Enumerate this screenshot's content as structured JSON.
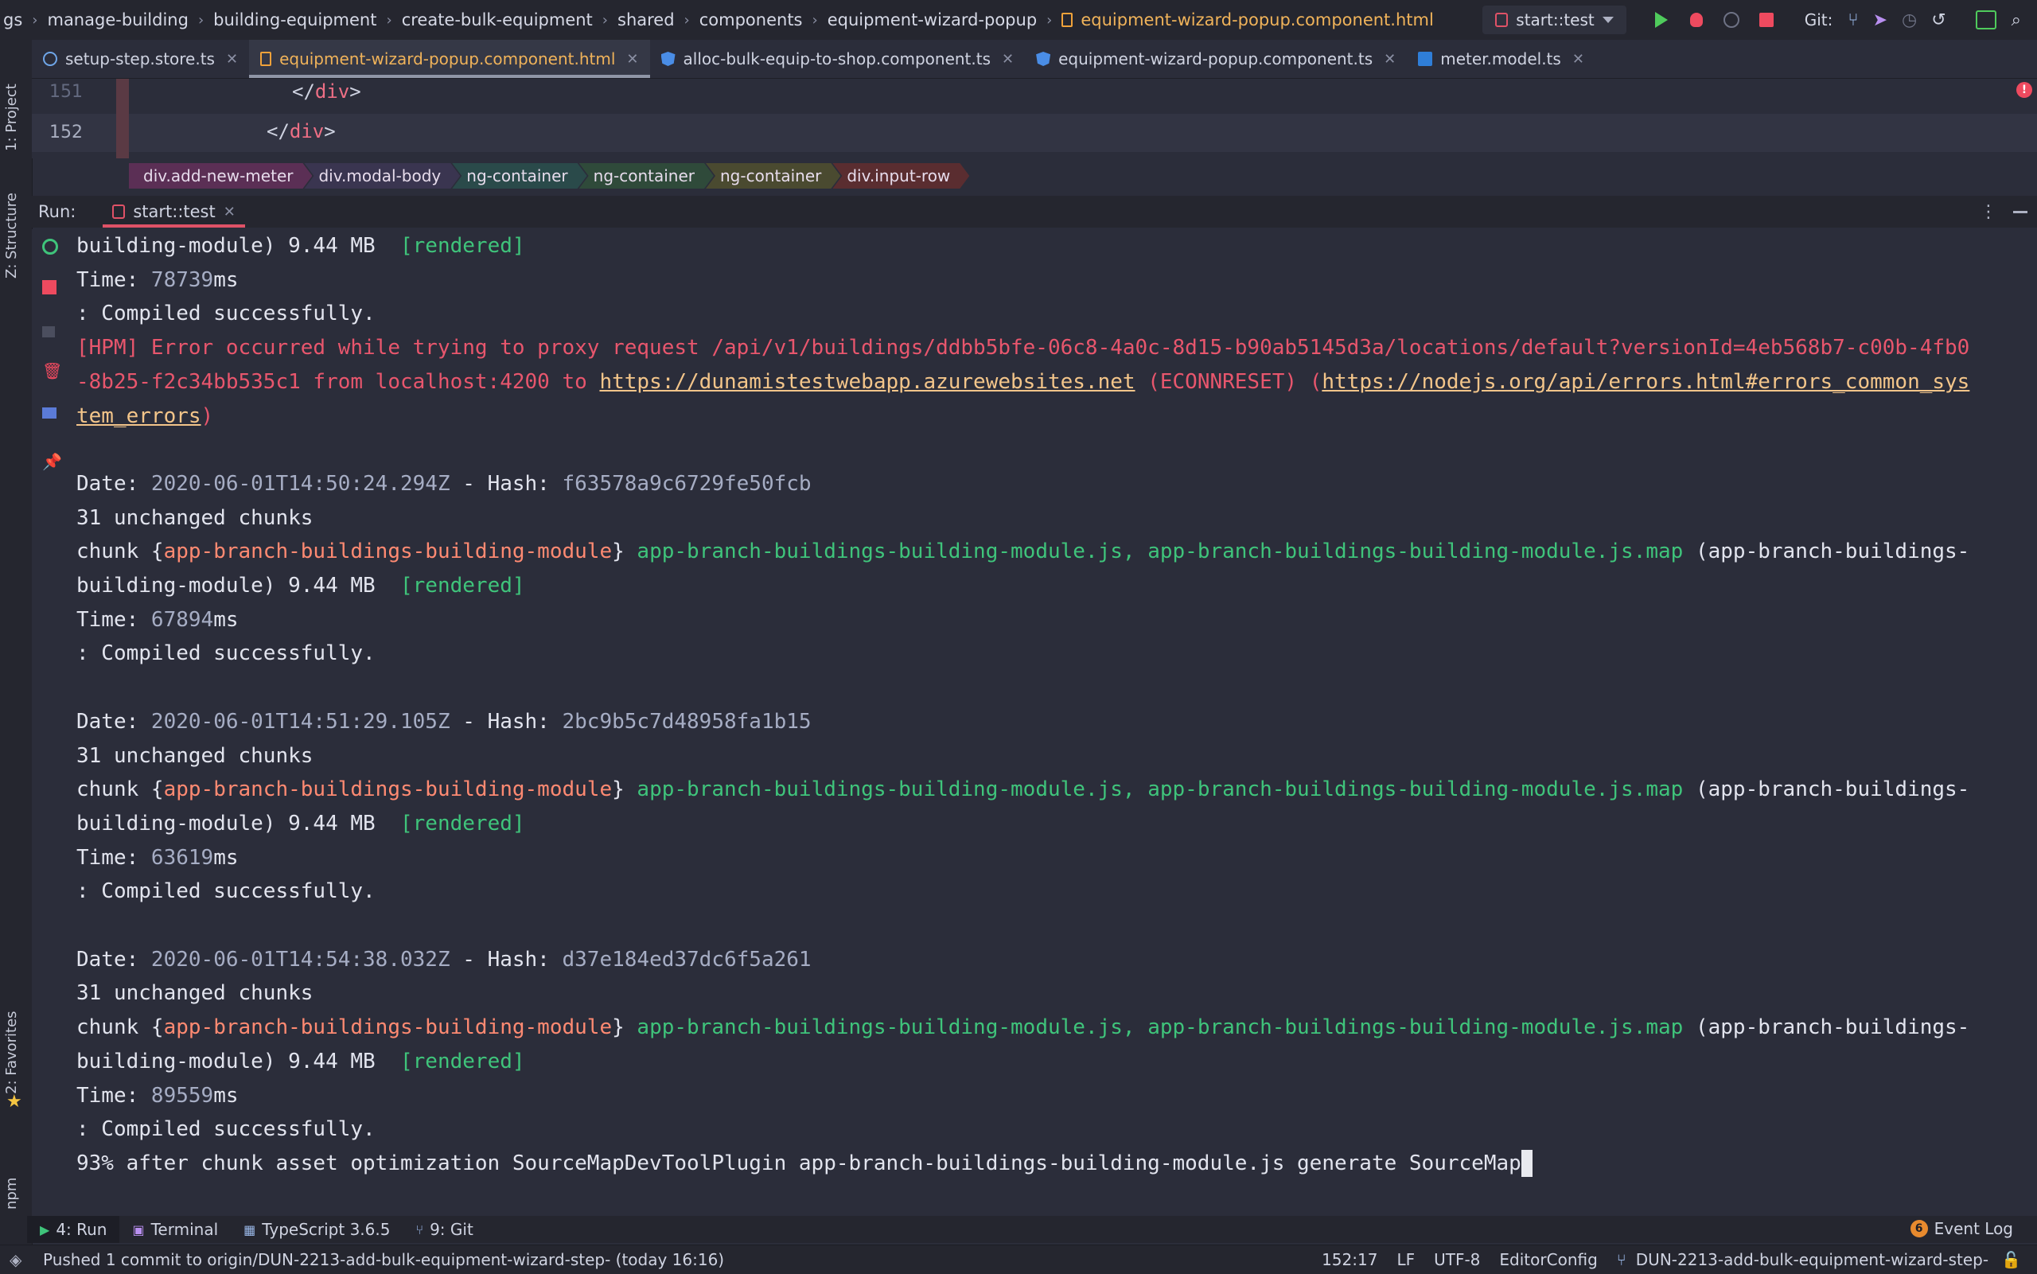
{
  "navbar": {
    "crumbs": [
      "gs",
      "manage-building",
      "building-equipment",
      "create-bulk-equipment",
      "shared",
      "components",
      "equipment-wizard-popup"
    ],
    "current_file": "equipment-wizard-popup.component.html",
    "run_config": "start::test",
    "git_label": "Git:"
  },
  "tool_strip": {
    "project": "1: Project",
    "structure": "Z: Structure",
    "favorites": "2: Favorites",
    "npm": "npm"
  },
  "tabs": [
    {
      "name": "setup-step.store.ts",
      "icon": "store"
    },
    {
      "name": "equipment-wizard-popup.component.html",
      "icon": "html",
      "active": true
    },
    {
      "name": "alloc-bulk-equip-to-shop.component.ts",
      "icon": "ng"
    },
    {
      "name": "equipment-wizard-popup.component.ts",
      "icon": "ng"
    },
    {
      "name": "meter.model.ts",
      "icon": "ts"
    }
  ],
  "editor": {
    "lines": [
      {
        "num": "151",
        "open": "</",
        "tag": "div",
        "close": ">"
      },
      {
        "num": "152",
        "open": "</",
        "tag": "div",
        "close": ">"
      }
    ],
    "error_count": "!"
  },
  "tag_crumbs": [
    {
      "label": "div.add-new-meter",
      "color": "#5b2f55"
    },
    {
      "label": "div.modal-body",
      "color": "#3a3550"
    },
    {
      "label": "ng-container",
      "color": "#2a4a4a"
    },
    {
      "label": "ng-container",
      "color": "#2f4a3a"
    },
    {
      "label": "ng-container",
      "color": "#4a4a30"
    },
    {
      "label": "div.input-row",
      "color": "#5a2d30"
    }
  ],
  "run": {
    "label": "Run:",
    "tab": "start::test"
  },
  "console": {
    "lines": [
      [
        {
          "t": "building-module) 9.44 MB  "
        },
        {
          "t": "[rendered]",
          "c": "green"
        }
      ],
      [
        {
          "t": "Time: "
        },
        {
          "t": "78739",
          "c": "gray"
        },
        {
          "t": "ms"
        }
      ],
      [
        {
          "t": ": Compiled successfully."
        }
      ],
      [
        {
          "t": "[HPM] Error occurred while trying to proxy request /api/v1/buildings/ddbb5bfe-06c8-4a0c-8d15-b90ab5145d3a/locations/default?versionId=4eb568b7-c00b-4fb0",
          "c": "err"
        }
      ],
      [
        {
          "t": "-8b25-f2c34bb535c1 from localhost:4200 to ",
          "c": "err"
        },
        {
          "t": "https://dunamistestwebapp.azurewebsites.net",
          "c": "link"
        },
        {
          "t": " (ECONNRESET) (",
          "c": "err"
        },
        {
          "t": "https://nodejs.org/api/errors.html#errors_common_sys",
          "c": "link"
        }
      ],
      [
        {
          "t": "tem_errors",
          "c": "link"
        },
        {
          "t": ")",
          "c": "err"
        }
      ],
      [
        {
          "t": ""
        }
      ],
      [
        {
          "t": "Date: "
        },
        {
          "t": "2020-06-01T14:50:24.294Z",
          "c": "gray"
        },
        {
          "t": " - Hash: "
        },
        {
          "t": "f63578a9c6729fe50fcb",
          "c": "gray"
        }
      ],
      [
        {
          "t": "31 unchanged chunks"
        }
      ],
      [
        {
          "t": "chunk {"
        },
        {
          "t": "app-branch-buildings-building-module",
          "c": "orange"
        },
        {
          "t": "} "
        },
        {
          "t": "app-branch-buildings-building-module.js, app-branch-buildings-building-module.js.map",
          "c": "green"
        },
        {
          "t": " (app-branch-buildings-"
        }
      ],
      [
        {
          "t": "building-module) 9.44 MB  "
        },
        {
          "t": "[rendered]",
          "c": "green"
        }
      ],
      [
        {
          "t": "Time: "
        },
        {
          "t": "67894",
          "c": "gray"
        },
        {
          "t": "ms"
        }
      ],
      [
        {
          "t": ": Compiled successfully."
        }
      ],
      [
        {
          "t": ""
        }
      ],
      [
        {
          "t": "Date: "
        },
        {
          "t": "2020-06-01T14:51:29.105Z",
          "c": "gray"
        },
        {
          "t": " - Hash: "
        },
        {
          "t": "2bc9b5c7d48958fa1b15",
          "c": "gray"
        }
      ],
      [
        {
          "t": "31 unchanged chunks"
        }
      ],
      [
        {
          "t": "chunk {"
        },
        {
          "t": "app-branch-buildings-building-module",
          "c": "orange"
        },
        {
          "t": "} "
        },
        {
          "t": "app-branch-buildings-building-module.js, app-branch-buildings-building-module.js.map",
          "c": "green"
        },
        {
          "t": " (app-branch-buildings-"
        }
      ],
      [
        {
          "t": "building-module) 9.44 MB  "
        },
        {
          "t": "[rendered]",
          "c": "green"
        }
      ],
      [
        {
          "t": "Time: "
        },
        {
          "t": "63619",
          "c": "gray"
        },
        {
          "t": "ms"
        }
      ],
      [
        {
          "t": ": Compiled successfully."
        }
      ],
      [
        {
          "t": ""
        }
      ],
      [
        {
          "t": "Date: "
        },
        {
          "t": "2020-06-01T14:54:38.032Z",
          "c": "gray"
        },
        {
          "t": " - Hash: "
        },
        {
          "t": "d37e184ed37dc6f5a261",
          "c": "gray"
        }
      ],
      [
        {
          "t": "31 unchanged chunks"
        }
      ],
      [
        {
          "t": "chunk {"
        },
        {
          "t": "app-branch-buildings-building-module",
          "c": "orange"
        },
        {
          "t": "} "
        },
        {
          "t": "app-branch-buildings-building-module.js, app-branch-buildings-building-module.js.map",
          "c": "green"
        },
        {
          "t": " (app-branch-buildings-"
        }
      ],
      [
        {
          "t": "building-module) 9.44 MB  "
        },
        {
          "t": "[rendered]",
          "c": "green"
        }
      ],
      [
        {
          "t": "Time: "
        },
        {
          "t": "89559",
          "c": "gray"
        },
        {
          "t": "ms"
        }
      ],
      [
        {
          "t": ": Compiled successfully."
        }
      ],
      [
        {
          "t": "93% after chunk asset optimization SourceMapDevToolPlugin app-branch-buildings-building-module.js generate SourceMap"
        }
      ]
    ]
  },
  "tool_tabs": [
    {
      "label": "4: Run",
      "active": true
    },
    {
      "label": "Terminal"
    },
    {
      "label": "TypeScript 3.6.5"
    },
    {
      "label": "9: Git"
    }
  ],
  "event_log": {
    "count": "6",
    "label": "Event Log"
  },
  "status": {
    "message": "Pushed 1 commit to origin/DUN-2213-add-bulk-equipment-wizard-step- (today 16:16)",
    "position": "152:17",
    "line_sep": "LF",
    "encoding": "UTF-8",
    "editor_config": "EditorConfig",
    "branch": "DUN-2213-add-bulk-equipment-wizard-step-"
  }
}
